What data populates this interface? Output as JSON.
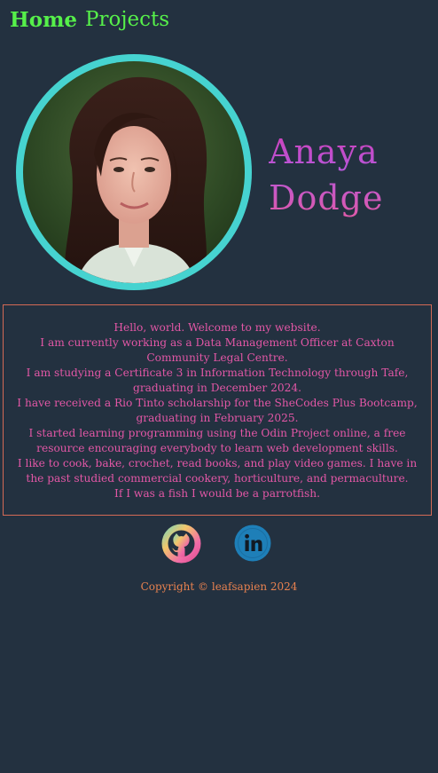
{
  "nav": {
    "home_label": "Home",
    "projects_label": "Projects"
  },
  "profile": {
    "first_name": "Anaya",
    "last_name": "Dodge"
  },
  "about": {
    "lines": [
      "Hello, world. Welcome to my website.",
      "I am currently working as a Data Management Officer at Caxton Community Legal Centre.",
      "I am studying a Certificate 3 in Information Technology through Tafe, graduating in December 2024.",
      "I have received a Rio Tinto scholarship for the SheCodes Plus Bootcamp, graduating in February 2025.",
      "I started learning programming using the Odin Project online, a free resource encouraging everybody to learn web development skills.",
      "I like to cook, bake, crochet, read books, and play video games. I have in the past studied commercial cookery, horticulture, and permaculture.",
      "If I was a fish I would be a parrotfish."
    ]
  },
  "socials": {
    "github_icon": "github-icon",
    "linkedin_icon": "linkedin-icon"
  },
  "footer": {
    "copyright": "Copyright © leafsapien 2024"
  },
  "colors": {
    "background": "#233140",
    "nav": "#56f04a",
    "ring": "#46d3d0",
    "text_pink": "#e357a6",
    "border_orange": "#d36a55",
    "footer_orange": "#e7814f"
  }
}
